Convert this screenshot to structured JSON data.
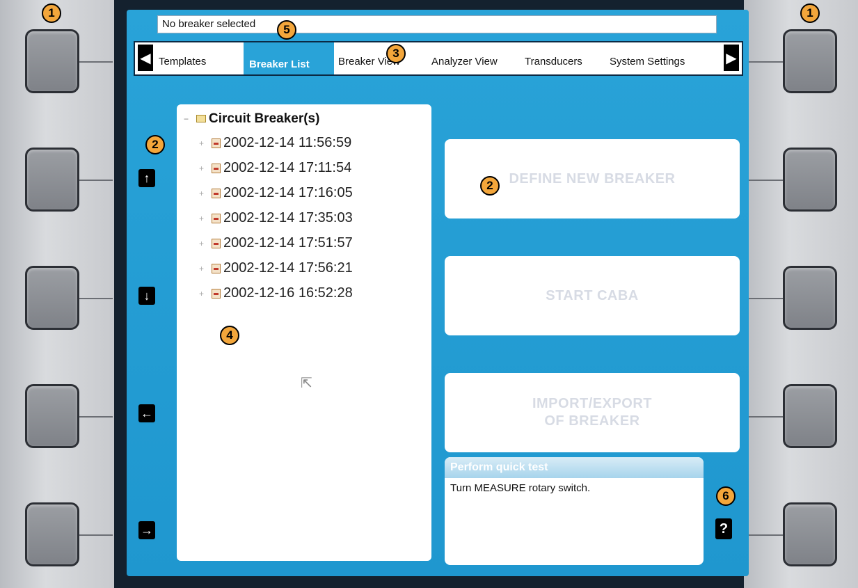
{
  "status_bar": {
    "text": "No breaker selected"
  },
  "tabs": [
    {
      "label": "Templates"
    },
    {
      "label": "Breaker List"
    },
    {
      "label": "Breaker View"
    },
    {
      "label": "Analyzer View"
    },
    {
      "label": "Transducers"
    },
    {
      "label": "System Settings"
    }
  ],
  "tree": {
    "root": "Circuit Breaker(s)",
    "items": [
      "2002-12-14 11:56:59",
      "2002-12-14 17:11:54",
      "2002-12-14 17:16:05",
      "2002-12-14 17:35:03",
      "2002-12-14 17:51:57",
      "2002-12-14 17:56:21",
      "2002-12-16 16:52:28"
    ]
  },
  "nav_buttons": {
    "up": "↑",
    "down": "↓",
    "left": "←",
    "right": "→"
  },
  "actions": {
    "define_new_breaker": "DEFINE NEW BREAKER",
    "start_caba": "START CABA",
    "import_export_line1": "IMPORT/EXPORT",
    "import_export_line2": "OF BREAKER"
  },
  "quick_test": {
    "title": "Perform quick test",
    "text": "Turn MEASURE rotary switch."
  },
  "help_button": {
    "label": "?"
  },
  "callouts": [
    "1",
    "1",
    "2",
    "2",
    "3",
    "4",
    "5",
    "6"
  ]
}
